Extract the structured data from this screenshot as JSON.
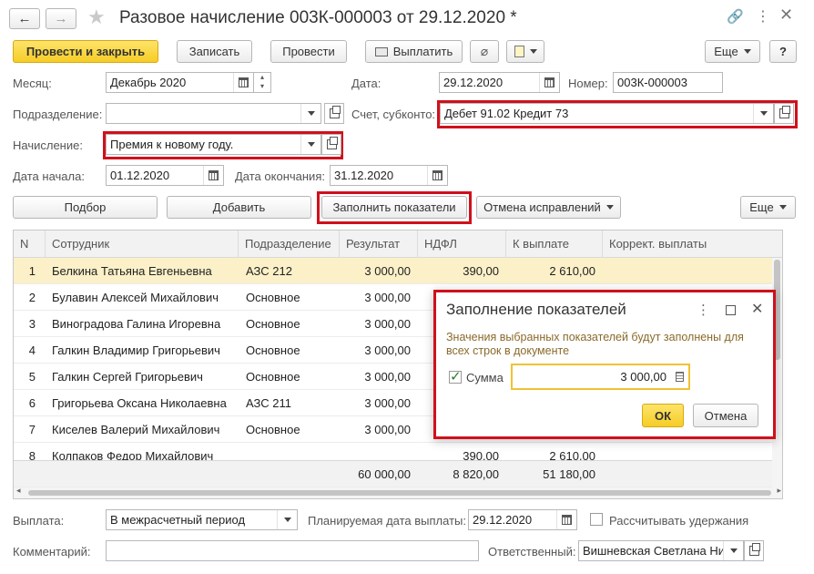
{
  "window": {
    "title": "Разовое начисление 003К-000003 от 29.12.2020 *"
  },
  "toolbar": {
    "post_close": "Провести и закрыть",
    "save": "Записать",
    "post": "Провести",
    "pay": "Выплатить",
    "more": "Еще",
    "help": "?"
  },
  "form": {
    "month_label": "Месяц:",
    "month_value": "Декабрь 2020",
    "date_label": "Дата:",
    "date_value": "29.12.2020",
    "number_label": "Номер:",
    "number_value": "003К-000003",
    "division_label": "Подразделение:",
    "division_value": "",
    "account_label": "Счет, субконто:",
    "account_value": "Дебет 91.02 Кредит 73",
    "accrual_label": "Начисление:",
    "accrual_value": "Премия к новому году.",
    "start_label": "Дата начала:",
    "start_value": "01.12.2020",
    "end_label": "Дата окончания:",
    "end_value": "31.12.2020"
  },
  "table_toolbar": {
    "pick": "Подбор",
    "add": "Добавить",
    "fill": "Заполнить показатели",
    "cancel_corrections": "Отмена исправлений",
    "more": "Еще"
  },
  "table": {
    "columns": [
      "N",
      "Сотрудник",
      "Подразделение",
      "Результат",
      "НДФЛ",
      "К выплате",
      "Коррект. выплаты"
    ],
    "rows": [
      {
        "n": "1",
        "name": "Белкина Татьяна Евгеньевна",
        "div": "АЗС 212",
        "result": "3 000,00",
        "ndfl": "390,00",
        "pay": "2 610,00"
      },
      {
        "n": "2",
        "name": "Булавин Алексей Михайлович",
        "div": "Основное",
        "result": "3 000,00",
        "ndfl": "",
        "pay": ""
      },
      {
        "n": "3",
        "name": "Виноградова Галина Игоревна",
        "div": "Основное",
        "result": "3 000,00",
        "ndfl": "",
        "pay": ""
      },
      {
        "n": "4",
        "name": "Галкин Владимир Григорьевич",
        "div": "Основное",
        "result": "3 000,00",
        "ndfl": "",
        "pay": ""
      },
      {
        "n": "5",
        "name": "Галкин Сергей Григорьевич",
        "div": "Основное",
        "result": "3 000,00",
        "ndfl": "",
        "pay": ""
      },
      {
        "n": "6",
        "name": "Григорьева Оксана Николаевна",
        "div": "АЗС 211",
        "result": "3 000,00",
        "ndfl": "",
        "pay": ""
      },
      {
        "n": "7",
        "name": "Киселев Валерий Михайлович",
        "div": "Основное",
        "result": "3 000,00",
        "ndfl": "",
        "pay": ""
      },
      {
        "n": "8",
        "name": "Колпаков Федор Михайлович",
        "div": "",
        "result": "",
        "ndfl": "390,00",
        "pay": "2 610,00"
      }
    ],
    "totals": {
      "result": "60 000,00",
      "ndfl": "8 820,00",
      "pay": "51 180,00"
    }
  },
  "footer": {
    "payment_label": "Выплата:",
    "payment_value": "В межрасчетный период",
    "planned_label": "Планируемая дата выплаты:",
    "planned_value": "29.12.2020",
    "withhold_label": "Рассчитывать удержания",
    "comment_label": "Комментарий:",
    "comment_value": "",
    "responsible_label": "Ответственный:",
    "responsible_value": "Вишневская Светлана Ни"
  },
  "dialog": {
    "title": "Заполнение показателей",
    "hint": "Значения выбранных показателей будут заполнены для всех строк в документе",
    "sum_label": "Сумма",
    "sum_value": "3 000,00",
    "ok": "ОК",
    "cancel": "Отмена"
  }
}
